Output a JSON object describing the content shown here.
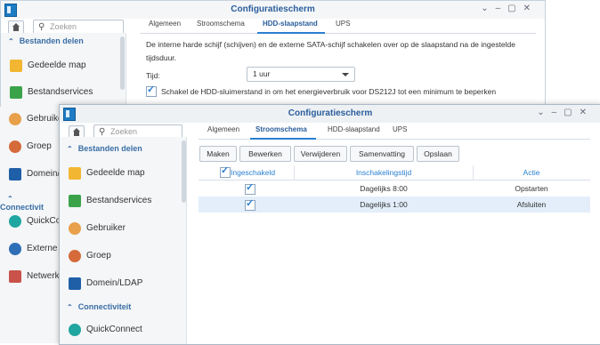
{
  "back": {
    "title": "Configuratiescherm",
    "search_placeholder": "Zoeken",
    "tabs": [
      {
        "label": "Algemeen"
      },
      {
        "label": "Stroomschema"
      },
      {
        "label": "HDD-slaapstand"
      },
      {
        "label": "UPS"
      }
    ],
    "sidebar": {
      "section1": "Bestanden delen",
      "items": [
        "Gedeelde map",
        "Bestandservices",
        "Gebruiker",
        "Groep",
        "Domein/"
      ],
      "section2": "Connectivit",
      "items2": [
        "QuickConn",
        "Externe",
        "Netwerk"
      ]
    },
    "description": "De interne harde schijf (schijven) en de externe SATA-schijf schakelen over op de slaapstand na de ingestelde tijdsduur.",
    "time_label": "Tijd:",
    "time_value": "1 uur",
    "checkbox_label": "Schakel de HDD-sluimerstand in om het energieverbruik voor DS212J tot een minimum te beperken"
  },
  "front": {
    "title": "Configuratiescherm",
    "search_placeholder": "Zoeken",
    "tabs": [
      {
        "label": "Algemeen"
      },
      {
        "label": "Stroomschema"
      },
      {
        "label": "HDD-slaapstand"
      },
      {
        "label": "UPS"
      }
    ],
    "toolbar": {
      "create": "Maken",
      "edit": "Bewerken",
      "delete": "Verwijderen",
      "summary": "Samenvatting",
      "save": "Opslaan"
    },
    "sidebar": {
      "section1": "Bestanden delen",
      "items": [
        "Gedeelde map",
        "Bestandservices",
        "Gebruiker",
        "Groep",
        "Domein/LDAP"
      ],
      "section2": "Connectiviteit",
      "items2": [
        "QuickConnect"
      ]
    },
    "table": {
      "headers": [
        "Ingeschakeld",
        "Inschakelingstijd",
        "Actie"
      ],
      "rows": [
        {
          "enabled": true,
          "time": "Dagelijks 8:00",
          "action": "Opstarten"
        },
        {
          "enabled": true,
          "time": "Dagelijks 1:00",
          "action": "Afsluiten"
        }
      ]
    }
  },
  "colors": {
    "accent": "#2a7fd1",
    "title": "#2a5d9a",
    "selected_row": "#e3eefa"
  }
}
